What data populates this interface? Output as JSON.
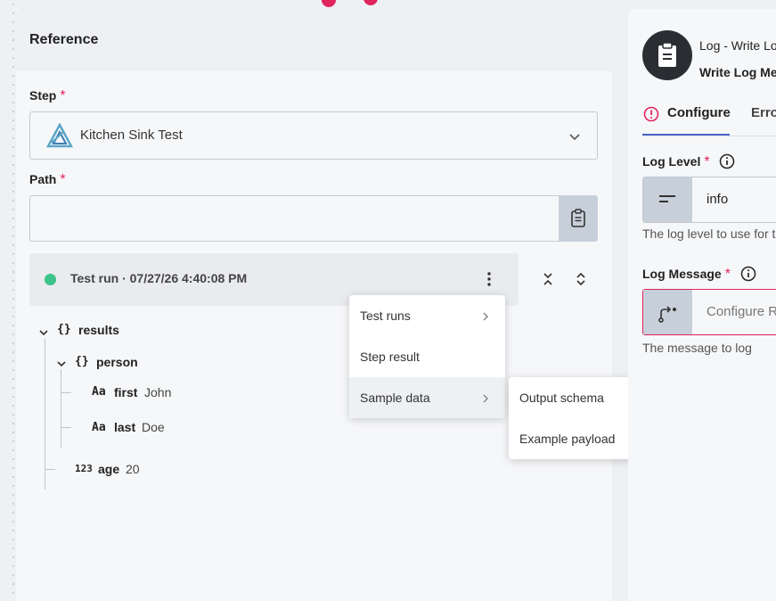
{
  "reference": {
    "title": "Reference",
    "step_label": "Step",
    "step_value": "Kitchen Sink Test",
    "path_label": "Path",
    "path_value": "",
    "required_mark": "*",
    "test_run_text": "Test run · 07/27/26 4:40:08 PM"
  },
  "tree": {
    "results_key": "results",
    "person_key": "person",
    "first_key": "first",
    "first_value": "John",
    "last_key": "last",
    "last_value": "Doe",
    "age_key": "age",
    "age_value": "20",
    "object_glyph": "{}",
    "string_glyph": "Aa",
    "number_glyph": "123"
  },
  "menu": {
    "items": [
      "Test runs",
      "Step result",
      "Sample data"
    ],
    "submenu": [
      "Output schema",
      "Example payload"
    ]
  },
  "right": {
    "title": "Log - Write Lo",
    "subtitle": "Write Log Me",
    "tab_configure": "Configure",
    "tab_errors": "Erro",
    "log_level_label": "Log Level",
    "log_level_value": "info",
    "log_level_help": "The log level to use for t",
    "log_message_label": "Log Message",
    "log_message_value": "Configure R",
    "log_message_help": "The message to log"
  },
  "colors": {
    "accent": "#4a67c7",
    "required": "#e0245e",
    "success": "#3cc48a"
  }
}
